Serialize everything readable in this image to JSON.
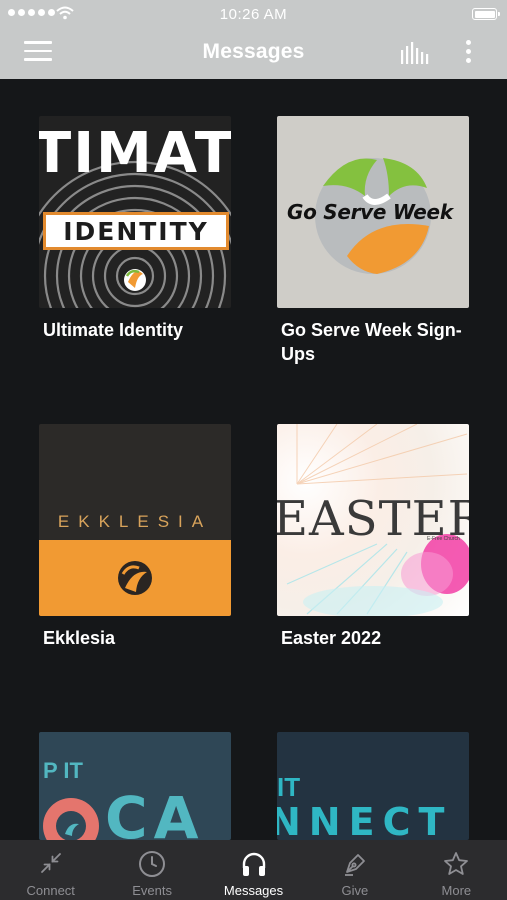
{
  "status_bar": {
    "time": "10:26 AM"
  },
  "header": {
    "title": "Messages"
  },
  "messages": [
    {
      "title": "Ultimate Identity",
      "art_text": "TIMAT",
      "art_band": "IDENTITY"
    },
    {
      "title": "Go Serve Week Sign-Ups",
      "art_text": "Go Serve Week"
    },
    {
      "title": "Ekklesia",
      "art_text": "EKKLESIA"
    },
    {
      "title": "Easter 2022",
      "art_text": "EASTER",
      "art_small": "E-Free Church"
    },
    {
      "title": "",
      "art_text": "CA",
      "art_small": "P IT"
    },
    {
      "title": "",
      "art_text": "NNECT",
      "art_small": "IT"
    }
  ],
  "tabs": [
    {
      "label": "Connect",
      "icon": "arrows-in-icon"
    },
    {
      "label": "Events",
      "icon": "clock-icon"
    },
    {
      "label": "Messages",
      "icon": "headphones-icon",
      "active": true
    },
    {
      "label": "Give",
      "icon": "pen-icon"
    },
    {
      "label": "More",
      "icon": "star-icon"
    }
  ],
  "colors": {
    "nav_bg": "#c7c9c9",
    "page_bg": "#151719",
    "tabbar_bg": "#2c2c2e",
    "tab_inactive": "#8e8e93",
    "tab_active": "#ffffff",
    "accent_orange": "#f19a33",
    "accent_teal": "#52b7c1"
  }
}
